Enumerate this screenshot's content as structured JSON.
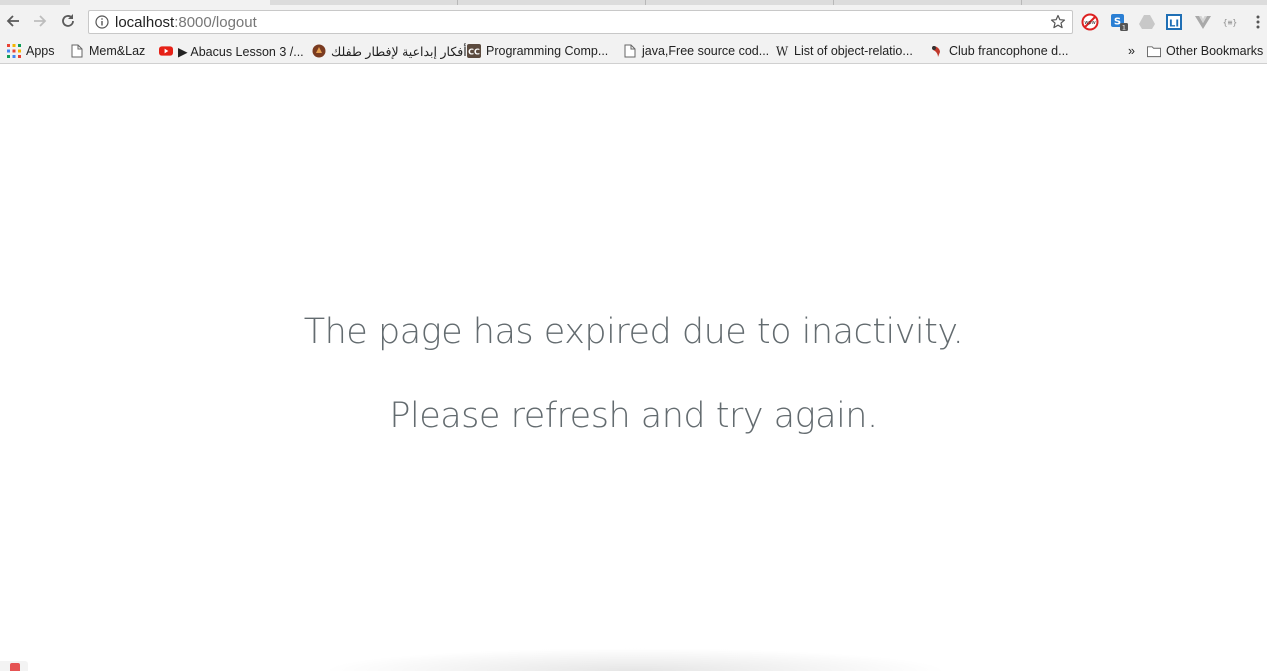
{
  "toolbar": {
    "url_host": "localhost",
    "url_path": ":8000/logout"
  },
  "bookmarks": {
    "apps": "Apps",
    "items": [
      "Mem&Laz",
      "▶ Abacus Lesson 3 /...",
      "أفكار إبداعية لإفطار طفلك...",
      "Programming Comp...",
      "java,Free source cod...",
      "List of object-relatio...",
      "Club francophone d..."
    ],
    "overflow": "»",
    "other": "Other Bookmarks"
  },
  "page": {
    "line1": "The page has expired due to inactivity.",
    "line2": "Please refresh and try again."
  },
  "colors": {
    "message_text": "#636b6f",
    "chrome_bg": "#f2f2f2"
  },
  "icons": [
    "back-icon",
    "forward-icon",
    "reload-icon",
    "info-icon",
    "star-icon",
    "menu-icon"
  ]
}
